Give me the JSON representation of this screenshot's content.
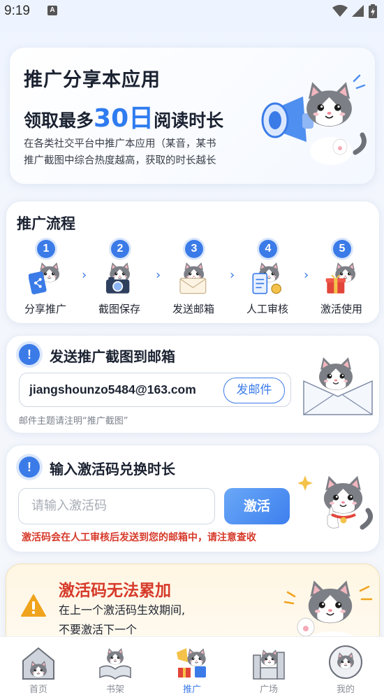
{
  "status_bar": {
    "time": "9:19",
    "notification_icon": "A"
  },
  "hero": {
    "title": "推广分享本应用",
    "subtitle_prefix": "领取最多",
    "subtitle_highlight": "30日",
    "subtitle_suffix": "阅读时长",
    "desc_line1": "在各类社交平台中推广本应用（某音，某书",
    "desc_line2": "推广截图中综合热度越高，获取的时长越长"
  },
  "process": {
    "title": "推广流程",
    "steps": [
      {
        "num": "1",
        "label": "分享推广",
        "icon": "share-icon"
      },
      {
        "num": "2",
        "label": "截图保存",
        "icon": "camera-icon"
      },
      {
        "num": "3",
        "label": "发送邮箱",
        "icon": "envelope-icon"
      },
      {
        "num": "4",
        "label": "人工审核",
        "icon": "clipboard-icon"
      },
      {
        "num": "5",
        "label": "激活使用",
        "icon": "gift-icon"
      }
    ],
    "arrow": "›"
  },
  "email": {
    "info": "!",
    "title": "发送推广截图到邮箱",
    "address": "jiangshounzo5484@163.com",
    "button": "发邮件",
    "note": "邮件主题请注明“推广截图”"
  },
  "activate": {
    "info": "!",
    "title": "输入激活码兑换时长",
    "placeholder": "请输入激活码",
    "button": "激活",
    "note": "激活码会在人工审核后发送到您的邮箱中，请注意查收"
  },
  "warning": {
    "title": "激活码无法累加",
    "line1": "在上一个激活码生效期间,",
    "line2": "不要激活下一个"
  },
  "nav": {
    "items": [
      {
        "label": "首页",
        "active": false
      },
      {
        "label": "书架",
        "active": false
      },
      {
        "label": "推广",
        "active": true
      },
      {
        "label": "广场",
        "active": false
      },
      {
        "label": "我的",
        "active": false
      }
    ]
  },
  "colors": {
    "accent": "#3b7be8",
    "warning": "#d63a2a",
    "highlight": "#2f7cf0"
  }
}
